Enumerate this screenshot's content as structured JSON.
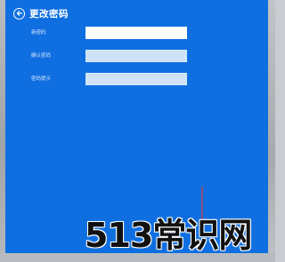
{
  "window": {
    "title": "更改密码"
  },
  "form": {
    "fields": [
      {
        "label": "新密码",
        "value": ""
      },
      {
        "label": "确认密码",
        "value": ""
      },
      {
        "label": "密码提示",
        "value": ""
      }
    ]
  },
  "watermark": {
    "text": "513常识网"
  },
  "colors": {
    "panel_background": "#0f6fe1",
    "active_input": "#ffffff",
    "inactive_input": "#cfe2f7",
    "text": "#ffffff"
  },
  "icons": {
    "back": "back-arrow-circle-icon"
  }
}
